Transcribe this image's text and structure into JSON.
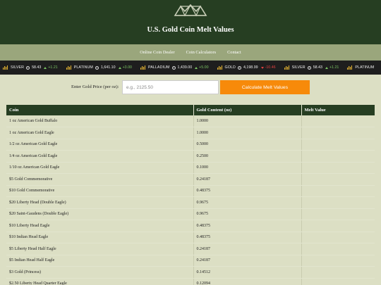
{
  "header": {
    "title": "U.S. Gold Coin Melt Values",
    "logo_icon": "mountain-logo-icon"
  },
  "nav": {
    "items": [
      {
        "label": "Online Coin Dealer"
      },
      {
        "label": "Coin Calculators"
      },
      {
        "label": "Contact"
      }
    ]
  },
  "ticker": {
    "items": [
      {
        "name": "SILVER",
        "price": "58.43",
        "change": "+1.21",
        "direction": "up"
      },
      {
        "name": "PLATINUM",
        "price": "1,641.10",
        "change": "+3.00",
        "direction": "up"
      },
      {
        "name": "PALLADIUM",
        "price": "1,439.00",
        "change": "+5.00",
        "direction": "up"
      },
      {
        "name": "GOLD",
        "price": "4,198.99",
        "change": "-10.46",
        "direction": "down"
      },
      {
        "name": "SILVER",
        "price": "58.43",
        "change": "+1.21",
        "direction": "up"
      },
      {
        "name": "PLATINUM",
        "price": "",
        "change": "",
        "direction": "up"
      }
    ],
    "colors": {
      "up": "#7bc463",
      "down": "#e04040"
    }
  },
  "calculator": {
    "label": "Enter Gold Price (per oz):",
    "input_value": "",
    "input_placeholder": "e.g., 2125.50",
    "button_label": "Calculate Melt Values"
  },
  "table": {
    "headers": [
      "Coin",
      "Gold Content (oz)",
      "Melt Value"
    ],
    "rows": [
      [
        "1 oz American Gold Buffalo",
        "1.0000",
        ""
      ],
      [
        "1 oz American Gold Eagle",
        "1.0000",
        ""
      ],
      [
        "1/2 oz American Gold Eagle",
        "0.5000",
        ""
      ],
      [
        "1/4 oz American Gold Eagle",
        "0.2500",
        ""
      ],
      [
        "1/10 oz American Gold Eagle",
        "0.1000",
        ""
      ],
      [
        "$5 Gold Commemorative",
        "0.24187",
        ""
      ],
      [
        "$10 Gold Commemorative",
        "0.48375",
        ""
      ],
      [
        "$20 Liberty Head (Double Eagle)",
        "0.9675",
        ""
      ],
      [
        "$20 Saint-Gaudens (Double Eagle)",
        "0.9675",
        ""
      ],
      [
        "$10 Liberty Head Eagle",
        "0.48375",
        ""
      ],
      [
        "$10 Indian Head Eagle",
        "0.48375",
        ""
      ],
      [
        "$5 Liberty Head Half Eagle",
        "0.24187",
        ""
      ],
      [
        "$5 Indian Head Half Eagle",
        "0.24187",
        ""
      ],
      [
        "$3 Gold (Princess)",
        "0.14512",
        ""
      ],
      [
        "$2.50 Liberty Head Quarter Eagle",
        "0.12094",
        ""
      ]
    ]
  },
  "colors": {
    "header_bg": "#263e22",
    "nav_bg": "#9aa67c",
    "page_bg": "#dcdfc4",
    "ticker_bg": "#1e1e1e",
    "button_bg": "#f78a0a"
  }
}
